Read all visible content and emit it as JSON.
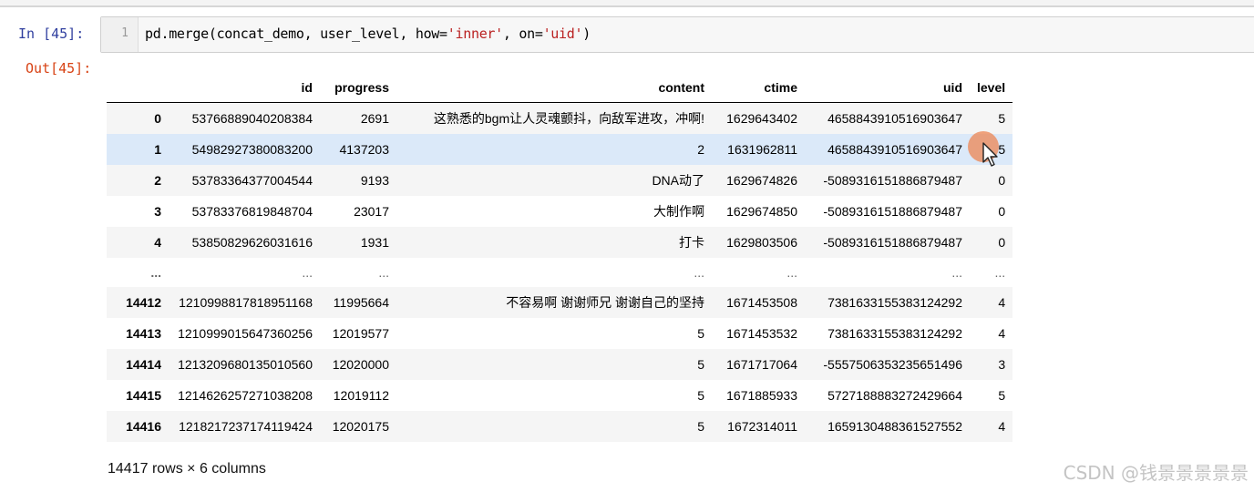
{
  "cell": {
    "in_prompt": "In  [45]:",
    "line_number": "1",
    "code_plain_1": "pd.merge(concat_demo, user_level, how=",
    "code_str_1": "'inner'",
    "code_plain_2": ", on=",
    "code_str_2": "'uid'",
    "code_plain_3": ")",
    "out_prompt": "Out[45]:"
  },
  "table": {
    "columns": [
      "",
      "id",
      "progress",
      "content",
      "ctime",
      "uid",
      "level"
    ],
    "rows": [
      {
        "index": "0",
        "id": "53766889040208384",
        "progress": "2691",
        "content": "这熟悉的bgm让人灵魂颤抖，向敌军进攻，冲啊!",
        "ctime": "1629643402",
        "uid": "4658843910516903647",
        "level": "5"
      },
      {
        "index": "1",
        "id": "54982927380083200",
        "progress": "4137203",
        "content": "2",
        "ctime": "1631962811",
        "uid": "4658843910516903647",
        "level": "5"
      },
      {
        "index": "2",
        "id": "53783364377004544",
        "progress": "9193",
        "content": "DNA动了",
        "ctime": "1629674826",
        "uid": "-5089316151886879487",
        "level": "0"
      },
      {
        "index": "3",
        "id": "53783376819848704",
        "progress": "23017",
        "content": "大制作啊",
        "ctime": "1629674850",
        "uid": "-5089316151886879487",
        "level": "0"
      },
      {
        "index": "4",
        "id": "53850829626031616",
        "progress": "1931",
        "content": "打卡",
        "ctime": "1629803506",
        "uid": "-5089316151886879487",
        "level": "0"
      },
      {
        "index": "...",
        "id": "...",
        "progress": "...",
        "content": "...",
        "ctime": "...",
        "uid": "...",
        "level": "..."
      },
      {
        "index": "14412",
        "id": "1210998817818951168",
        "progress": "11995664",
        "content": "不容易啊 谢谢师兄 谢谢自己的坚持",
        "ctime": "1671453508",
        "uid": "7381633155383124292",
        "level": "4"
      },
      {
        "index": "14413",
        "id": "1210999015647360256",
        "progress": "12019577",
        "content": "5",
        "ctime": "1671453532",
        "uid": "7381633155383124292",
        "level": "4"
      },
      {
        "index": "14414",
        "id": "1213209680135010560",
        "progress": "12020000",
        "content": "5",
        "ctime": "1671717064",
        "uid": "-5557506353235651496",
        "level": "3"
      },
      {
        "index": "14415",
        "id": "1214626257271038208",
        "progress": "12019112",
        "content": "5",
        "ctime": "1671885933",
        "uid": "5727188883272429664",
        "level": "5"
      },
      {
        "index": "14416",
        "id": "1218217237174119424",
        "progress": "12020175",
        "content": "5",
        "ctime": "1672314011",
        "uid": "1659130488361527552",
        "level": "4"
      }
    ],
    "shape_info": "14417 rows × 6 columns"
  },
  "watermark": "CSDN @钱景景景景景",
  "colors": {
    "in_prompt": "#303f9f",
    "out_prompt": "#d84315",
    "string_literal": "#ba2121",
    "highlight_row": "#dbe9f9"
  },
  "icons": {
    "cursor": "mouse-pointer-icon"
  }
}
